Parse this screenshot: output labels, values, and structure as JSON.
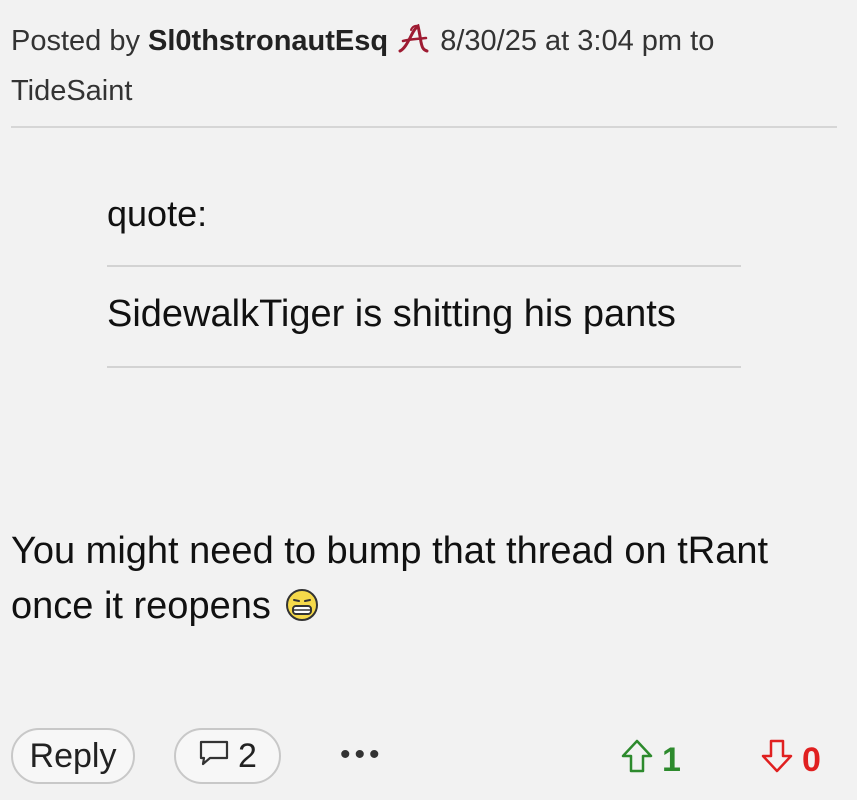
{
  "post": {
    "posted_by_prefix": "Posted by ",
    "author": "Sl0thstronautEsq",
    "timestamp": " 8/30/25 at 3:04 pm to",
    "recipient": "TideSaint",
    "team_logo_icon": "alabama-a-icon",
    "team_color": "#9e1b32"
  },
  "quote": {
    "label": "quote:",
    "text": "SidewalkTiger is shitting his pants"
  },
  "body": {
    "text": "You might need to bump that thread on tRant once it reopens",
    "emoji_icon": "grimacing-face-icon"
  },
  "actions": {
    "reply_label": "Reply",
    "comment_count": "2",
    "more_label": "•••",
    "upvotes": "1",
    "downvotes": "0",
    "up_color": "#2d8a2d",
    "down_color": "#e02020"
  }
}
